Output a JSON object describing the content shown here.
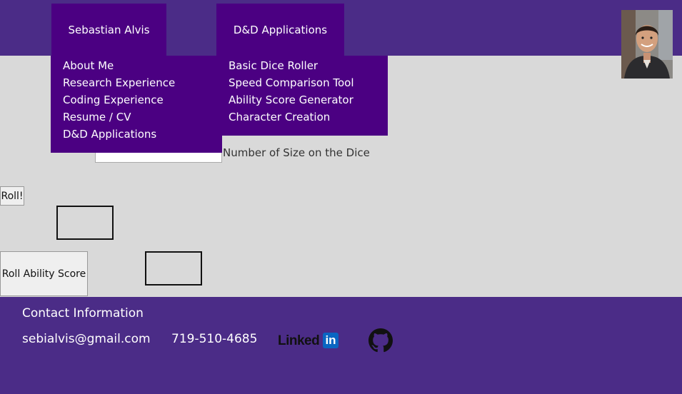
{
  "nav": {
    "tabs": [
      {
        "label": "Sebastian Alvis"
      },
      {
        "label": "D&D Applications"
      }
    ],
    "menu_sebastian": [
      "About Me",
      "Research Experience",
      "Coding Experience",
      "Resume / CV",
      "D&D Applications"
    ],
    "menu_dnd": [
      "Basic Dice Roller",
      "Speed Comparison Tool",
      "Ability Score Generator",
      "Character Creation"
    ]
  },
  "form": {
    "dice_size_label": "Number of Size on the Dice",
    "dice_size_value": "",
    "roll_button": "Roll!",
    "roll_ability_button": "Roll Ability Score"
  },
  "footer": {
    "title": "Contact Information",
    "email": "sebialvis@gmail.com",
    "phone": "719-510-4685",
    "linkedin_text": "Linked",
    "linkedin_in": "in"
  },
  "colors": {
    "header_bg": "#4b2c87",
    "menu_bg": "#4b0082",
    "page_bg": "#d9d9d9"
  },
  "icons": {
    "avatar": "profile-photo",
    "linkedin": "linkedin-logo",
    "github": "github-icon"
  }
}
